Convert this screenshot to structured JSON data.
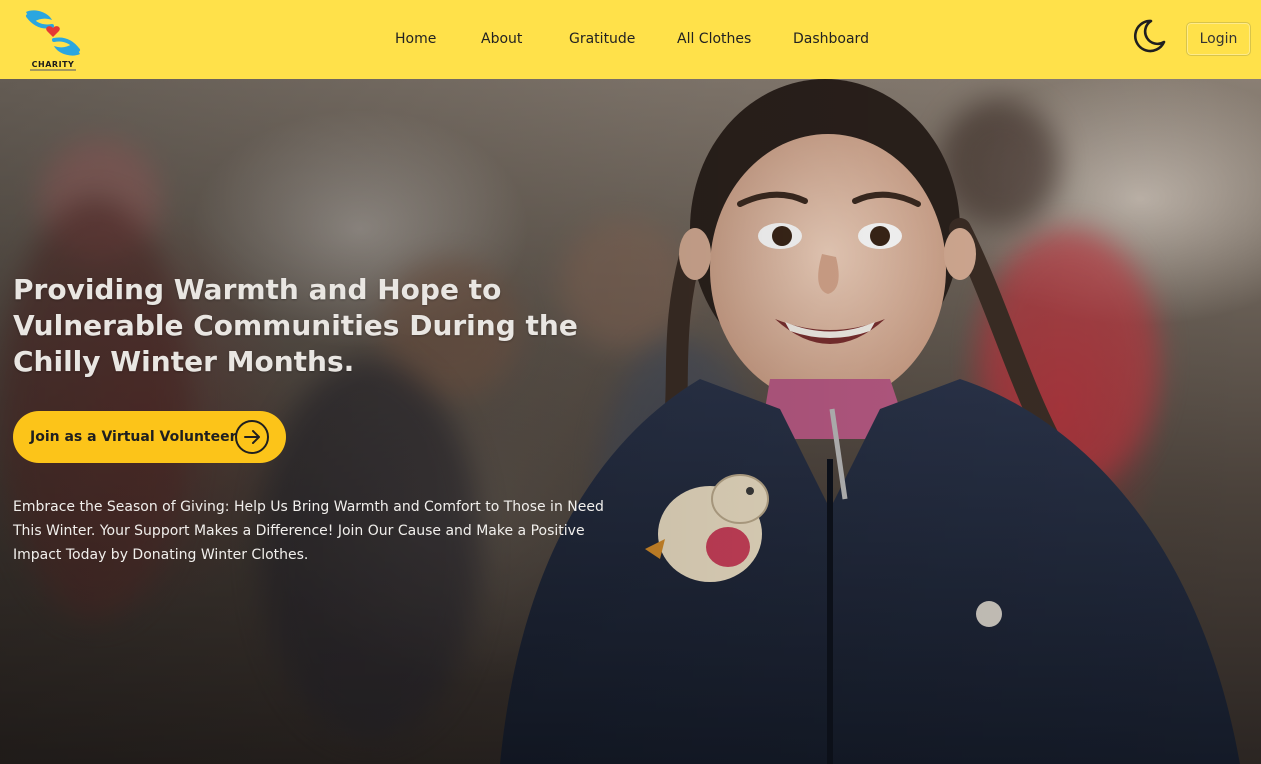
{
  "navbar": {
    "logo_text": "CHARITY",
    "links": [
      "Home",
      "About",
      "Gratitude",
      "All Clothes",
      "Dashboard"
    ],
    "theme_toggle_icon": "moon-icon",
    "login_label": "Login",
    "background_color": "#ffe14a"
  },
  "hero": {
    "title": "Providing Warmth and Hope to Vulnerable Communities During the Chilly Winter Months.",
    "cta_label": "Join as a Virtual Volunteer",
    "cta_icon": "arrow-right-circle-icon",
    "cta_color": "#fcc419",
    "description": "Embrace the Season of Giving: Help Us Bring Warmth and Comfort to Those in Need This Winter. Your Support Makes a Difference! Join Our Cause and Make a Positive Impact Today by Donating Winter Clothes."
  }
}
